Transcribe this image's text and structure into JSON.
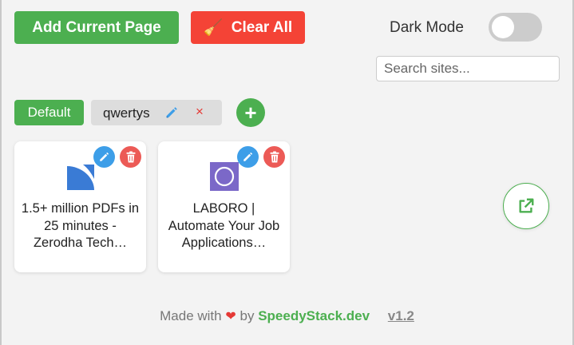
{
  "toolbar": {
    "add_label": "Add Current Page",
    "clear_label": "Clear All",
    "clear_icon": "broom-icon",
    "dark_mode_label": "Dark Mode",
    "dark_mode_on": false
  },
  "search": {
    "placeholder": "Search sites...",
    "value": ""
  },
  "groups": {
    "items": [
      {
        "label": "Default",
        "active": true
      },
      {
        "label": "qwertys",
        "active": false
      }
    ],
    "add_icon": "+",
    "close_icon": "×"
  },
  "cards": [
    {
      "title": "1.5+ million PDFs in 25 minutes - Zerodha Tech…",
      "icon": "zerodha-logo-icon"
    },
    {
      "title": "LABORO | Automate Your Job Applications…",
      "icon": "laboro-logo-icon"
    }
  ],
  "footer": {
    "made_with": "Made with",
    "heart": "❤",
    "by": "by",
    "brand": "SpeedyStack.dev",
    "version": "v1.2"
  },
  "colors": {
    "primary_green": "#4caf50",
    "danger_red": "#f44336",
    "edit_blue": "#3d9ee8",
    "delete_red": "#ec5a56"
  }
}
